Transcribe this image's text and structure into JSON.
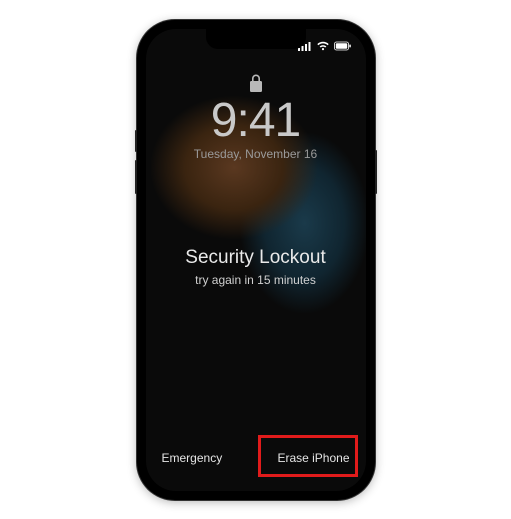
{
  "clock": {
    "time": "9:41",
    "date": "Tuesday, November 16"
  },
  "lockout": {
    "title": "Security Lockout",
    "subtitle": "try again in 15 minutes"
  },
  "buttons": {
    "emergency": "Emergency",
    "erase": "Erase iPhone"
  },
  "highlight_color": "#e11b1b"
}
